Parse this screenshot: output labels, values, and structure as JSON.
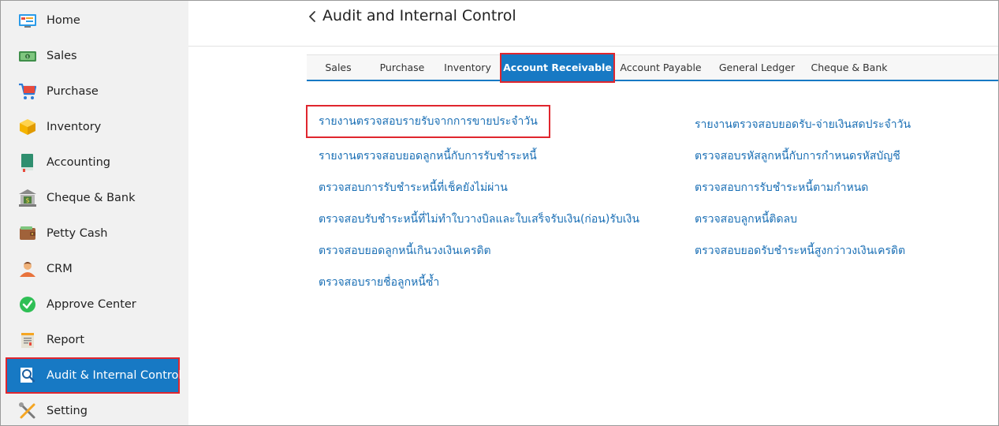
{
  "sidebar": {
    "items": [
      {
        "label": "Home",
        "icon": "home-icon"
      },
      {
        "label": "Sales",
        "icon": "money-icon"
      },
      {
        "label": "Purchase",
        "icon": "cart-icon"
      },
      {
        "label": "Inventory",
        "icon": "box-icon"
      },
      {
        "label": "Accounting",
        "icon": "book-icon"
      },
      {
        "label": "Cheque & Bank",
        "icon": "bank-icon"
      },
      {
        "label": "Petty Cash",
        "icon": "wallet-icon"
      },
      {
        "label": "CRM",
        "icon": "people-icon"
      },
      {
        "label": "Approve Center",
        "icon": "check-circle-icon"
      },
      {
        "label": "Report",
        "icon": "report-icon"
      },
      {
        "label": "Audit & Internal Control",
        "icon": "audit-search-icon"
      },
      {
        "label": "Setting",
        "icon": "tools-icon"
      }
    ],
    "active_index": 10
  },
  "header": {
    "title": "Audit and Internal Control"
  },
  "tabs": [
    {
      "label": "Sales"
    },
    {
      "label": "Purchase"
    },
    {
      "label": "Inventory"
    },
    {
      "label": "Account Receivable"
    },
    {
      "label": "Account Payable"
    },
    {
      "label": "General Ledger"
    },
    {
      "label": "Cheque & Bank"
    }
  ],
  "active_tab_index": 3,
  "links": {
    "left": [
      "รายงานตรวจสอบรายรับจากการขายประจำวัน",
      "รายงานตรวจสอบยอดลูกหนี้กับการรับชำระหนี้",
      "ตรวจสอบการรับชำระหนี้ที่เช็คยังไม่ผ่าน",
      "ตรวจสอบรับชำระหนี้ที่ไม่ทำใบวางบิลและใบเสร็จรับเงิน(ก่อน)รับเงิน",
      "ตรวจสอบยอดลูกหนี้เกินวงเงินเครดิต",
      "ตรวจสอบรายชื่อลูกหนี้ซ้ำ"
    ],
    "right": [
      "รายงานตรวจสอบยอดรับ-จ่ายเงินสดประจำวัน",
      "ตรวจสอบรหัสลูกหนี้กับการกำหนดรหัสบัญชี",
      "ตรวจสอบการรับชำระหนี้ตามกำหนด",
      "ตรวจสอบลูกหนี้ติดลบ",
      "ตรวจสอบยอดรับชำระหนี้สูงกว่าวงเงินเครดิต"
    ]
  },
  "colors": {
    "accent": "#1779c4",
    "highlight": "#e0262e",
    "link": "#1a6fb5"
  }
}
